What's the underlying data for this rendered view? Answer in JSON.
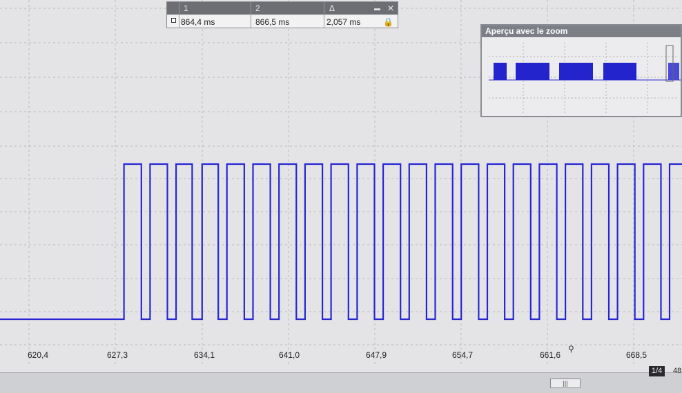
{
  "cursor_bar": {
    "cursor1_label": "1",
    "cursor2_label": "2",
    "delta_label": "Δ",
    "cursor1_value": "864,4 ms",
    "cursor2_value": "866,5 ms",
    "delta_value": "2,057 ms",
    "minimize_glyph": "▬",
    "close_glyph": "✕",
    "lock_icon": "lock-icon"
  },
  "zoom_panel": {
    "title": "Aperçu avec le zoom"
  },
  "time_axis": {
    "unit": "ms",
    "ticks": [
      "620,4",
      "627,3",
      "634,1",
      "641,0",
      "647,9",
      "654,7",
      "661,6",
      "668,5"
    ]
  },
  "status": {
    "page_badge": "1/4",
    "page_extra": "48"
  },
  "colors": {
    "trace": "#2626d4",
    "background": "#e4e4e6",
    "grid": "#b8b8bc"
  },
  "chart_data": {
    "type": "line",
    "title": "",
    "xlabel": "",
    "ylabel": "",
    "x_ticks": [
      "620,4",
      "627,3",
      "634,1",
      "641,0",
      "647,9",
      "654,7",
      "661,6",
      "668,5"
    ],
    "x_range": [
      617.5,
      672.5
    ],
    "y_range": [
      0,
      1
    ],
    "grid": true,
    "series": [
      {
        "levels": [
          [
            617.5,
            0
          ],
          [
            627.5,
            1
          ],
          [
            628.9,
            0
          ],
          [
            629.6,
            1
          ],
          [
            631.0,
            0
          ],
          [
            631.7,
            1
          ],
          [
            633.0,
            0
          ],
          [
            633.8,
            1
          ],
          [
            635.1,
            0
          ],
          [
            635.8,
            1
          ],
          [
            637.2,
            0
          ],
          [
            637.9,
            1
          ],
          [
            639.3,
            0
          ],
          [
            640.0,
            1
          ],
          [
            641.4,
            0
          ],
          [
            642.1,
            1
          ],
          [
            643.5,
            0
          ],
          [
            644.2,
            1
          ],
          [
            645.6,
            0
          ],
          [
            646.3,
            1
          ],
          [
            647.7,
            0
          ],
          [
            648.4,
            1
          ],
          [
            649.8,
            0
          ],
          [
            650.5,
            1
          ],
          [
            651.9,
            0
          ],
          [
            652.6,
            1
          ],
          [
            654.0,
            0
          ],
          [
            654.7,
            1
          ],
          [
            656.1,
            0
          ],
          [
            656.8,
            1
          ],
          [
            658.2,
            0
          ],
          [
            658.9,
            1
          ],
          [
            660.3,
            0
          ],
          [
            661.0,
            1
          ],
          [
            662.4,
            0
          ],
          [
            663.1,
            1
          ],
          [
            664.5,
            0
          ],
          [
            665.2,
            1
          ],
          [
            666.6,
            0
          ],
          [
            667.3,
            1
          ],
          [
            668.7,
            0
          ],
          [
            669.4,
            1
          ],
          [
            670.8,
            0
          ],
          [
            671.5,
            1
          ]
        ]
      }
    ]
  }
}
